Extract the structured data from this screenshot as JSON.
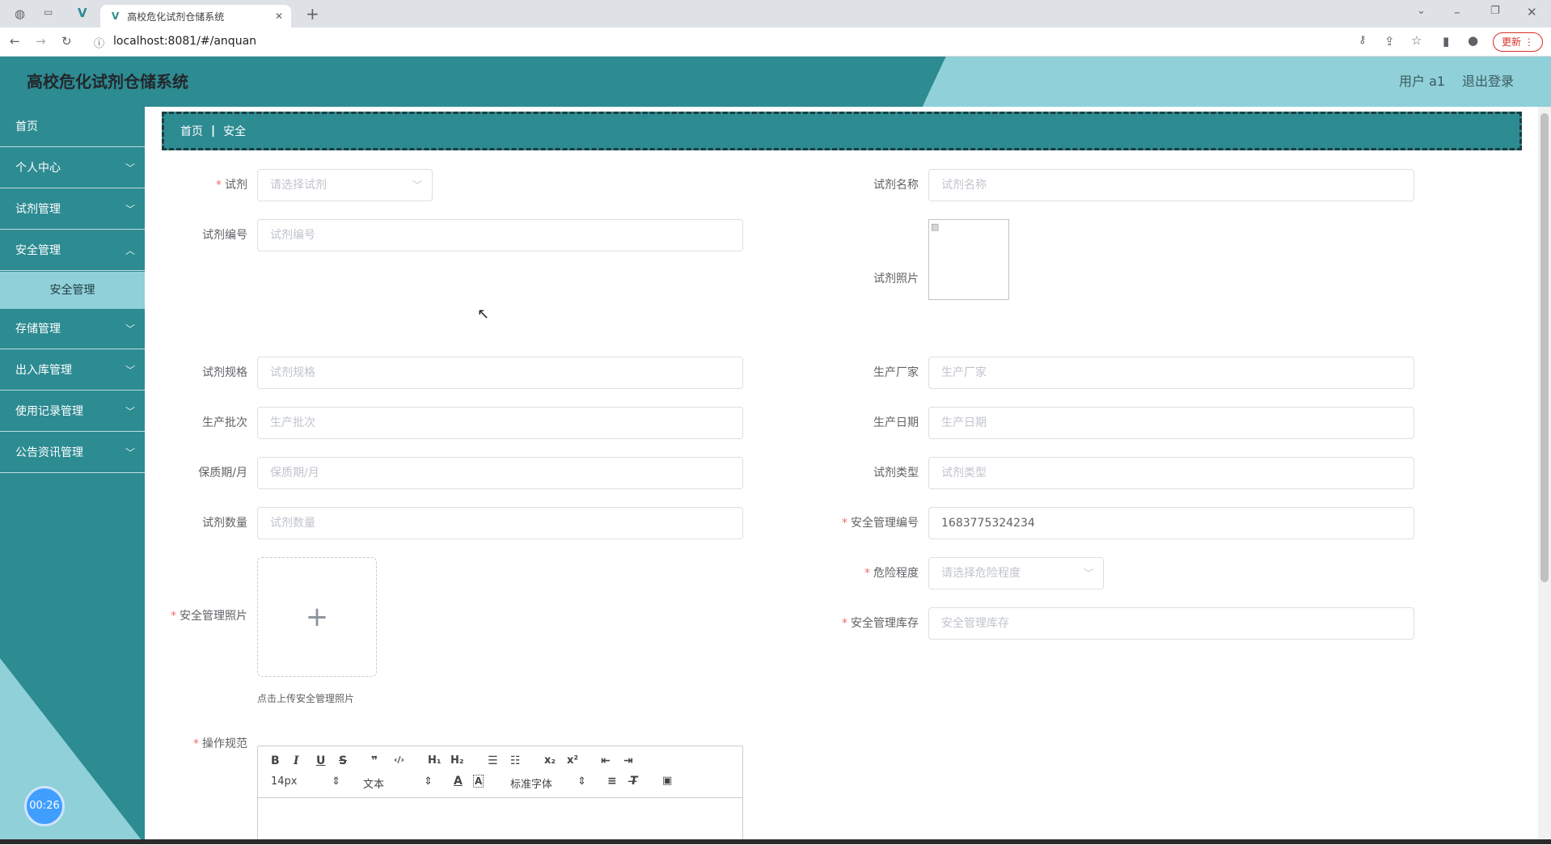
{
  "browser": {
    "tab_title": "高校危化试剂仓储系统",
    "new_tab": "+",
    "url": "localhost:8081/#/anquan",
    "update_label": "更新"
  },
  "header": {
    "title": "高校危化试剂仓储系统",
    "user": "用户 a1",
    "logout": "退出登录"
  },
  "sidebar": {
    "items": [
      {
        "label": "首页"
      },
      {
        "label": "个人中心"
      },
      {
        "label": "试剂管理"
      },
      {
        "label": "安全管理"
      },
      {
        "label": "存储管理"
      },
      {
        "label": "出入库管理"
      },
      {
        "label": "使用记录管理"
      },
      {
        "label": "公告资讯管理"
      }
    ],
    "active_sub": "安全管理",
    "timer": "00:26"
  },
  "breadcrumb": {
    "home": "首页",
    "sep": "|",
    "current": "安全"
  },
  "form": {
    "reagent": {
      "label": "试剂",
      "placeholder": "请选择试剂"
    },
    "reagent_name": {
      "label": "试剂名称",
      "placeholder": "试剂名称"
    },
    "reagent_code": {
      "label": "试剂编号",
      "placeholder": "试剂编号"
    },
    "reagent_photo": {
      "label": "试剂照片"
    },
    "spec": {
      "label": "试剂规格",
      "placeholder": "试剂规格"
    },
    "maker": {
      "label": "生产厂家",
      "placeholder": "生产厂家"
    },
    "batch": {
      "label": "生产批次",
      "placeholder": "生产批次"
    },
    "prod_date": {
      "label": "生产日期",
      "placeholder": "生产日期"
    },
    "shelf": {
      "label": "保质期/月",
      "placeholder": "保质期/月"
    },
    "type": {
      "label": "试剂类型",
      "placeholder": "试剂类型"
    },
    "qty": {
      "label": "试剂数量",
      "placeholder": "试剂数量"
    },
    "safety_code": {
      "label": "安全管理编号",
      "value": "1683775324234"
    },
    "danger": {
      "label": "危险程度",
      "placeholder": "请选择危险程度"
    },
    "safety_photo": {
      "label": "安全管理照片",
      "tip": "点击上传安全管理照片"
    },
    "safety_stock": {
      "label": "安全管理库存",
      "placeholder": "安全管理库存"
    },
    "operation": {
      "label": "操作规范"
    }
  },
  "editor": {
    "font_size": "14px",
    "block": "文本",
    "font": "标准字体"
  },
  "colors": {
    "teal": "#2d8b92",
    "light_teal": "#90d0d9",
    "required": "#f56c6c"
  }
}
